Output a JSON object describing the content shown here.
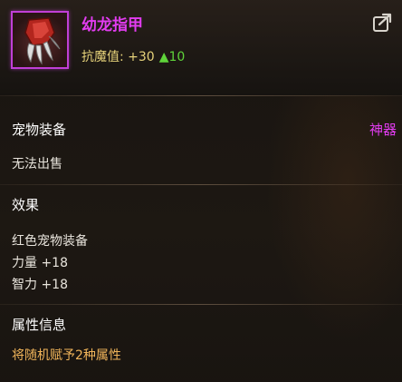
{
  "item": {
    "name": "幼龙指甲",
    "stat_label": "抗魔值:",
    "stat_bonus": "+30",
    "stat_up": "▲10",
    "icon": "dragon-claw-icon"
  },
  "header": {
    "share_icon": "share-icon"
  },
  "equip_section": {
    "title": "宠物装备",
    "quality_tag": "神器",
    "note": "无法出售"
  },
  "effect_section": {
    "title": "效果",
    "lines": [
      "红色宠物装备",
      "力量 +18",
      "智力 +18"
    ]
  },
  "attr_section": {
    "title": "属性信息",
    "desc": "将随机赋予2种属性"
  },
  "colors": {
    "name": "#e23cf0",
    "stat": "#e6d27a",
    "up": "#5fd43a",
    "attr_desc": "#f0b45a"
  }
}
